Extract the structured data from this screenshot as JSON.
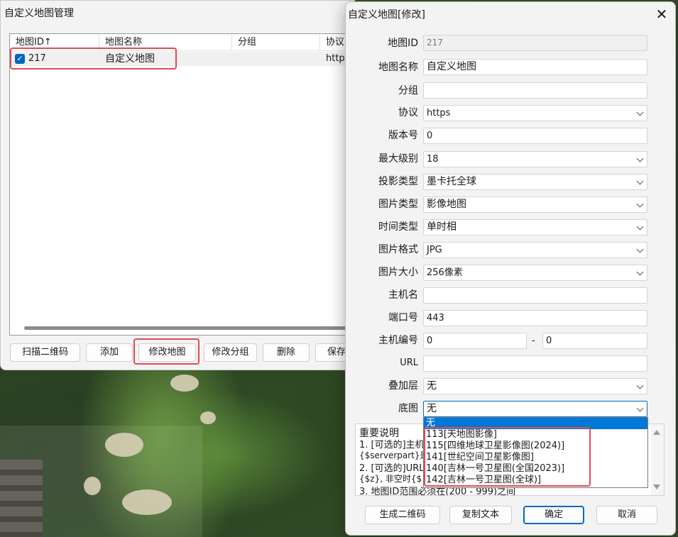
{
  "manager": {
    "title": "自定义地图管理",
    "columns": [
      "地图ID↑",
      "地图名称",
      "分组",
      "协议"
    ],
    "rows": [
      {
        "checked": true,
        "id": "217",
        "name": "自定义地图",
        "group": "",
        "protocol": "https"
      }
    ],
    "buttons": {
      "scan_qr": "扫描二维码",
      "add": "添加",
      "modify_map": "修改地图",
      "modify_group": "修改分组",
      "delete": "删除",
      "save": "保存"
    }
  },
  "dialog": {
    "title": "自定义地图[修改]",
    "close_glyph": "✕",
    "labels": {
      "map_id": "地图ID",
      "map_name": "地图名称",
      "group": "分组",
      "protocol": "协议",
      "version": "版本号",
      "max_level": "最大级别",
      "projection": "投影类型",
      "image_type": "图片类型",
      "time_type": "时间类型",
      "image_format": "图片格式",
      "image_size": "图片大小",
      "host": "主机名",
      "port": "端口号",
      "host_number": "主机编号",
      "url": "URL",
      "overlay": "叠加层",
      "base_map": "底图"
    },
    "values": {
      "map_id": "217",
      "map_name": "自定义地图",
      "group": "",
      "protocol": "https",
      "version": "0",
      "max_level": "18",
      "projection": "墨卡托全球",
      "image_type": "影像地图",
      "time_type": "单时相",
      "image_format": "JPG",
      "image_size": "256像素",
      "host": "",
      "port": "443",
      "host_number_from": "0",
      "host_number_sep": "-",
      "host_number_to": "0",
      "url": "",
      "overlay": "无",
      "base_map": "无"
    },
    "base_map_options": [
      "无",
      "113[天地图影像]",
      "115[四维地球卫星影像图(2024)]",
      "141[世纪空间卫星影像图]",
      "140[吉林一号卫星图(全国2023)]",
      "142[吉林一号卫星图(全球)]"
    ],
    "base_map_highlighted": "无",
    "notes_visible_lines": [
      "重要说明",
      "1. [可选的]主机",
      "{$serverpart}是",
      "2. [可选的]URL",
      "{$z}, 非空时{$",
      "3. 地图ID范围必须在(200 - 999)之间"
    ],
    "buttons": {
      "gen_qr": "生成二维码",
      "copy_text": "复制文本",
      "ok": "确定",
      "cancel": "取消"
    }
  },
  "colors": {
    "accent": "#0067c0",
    "highlight_box": "#e04b57",
    "selection": "#0078d7"
  }
}
